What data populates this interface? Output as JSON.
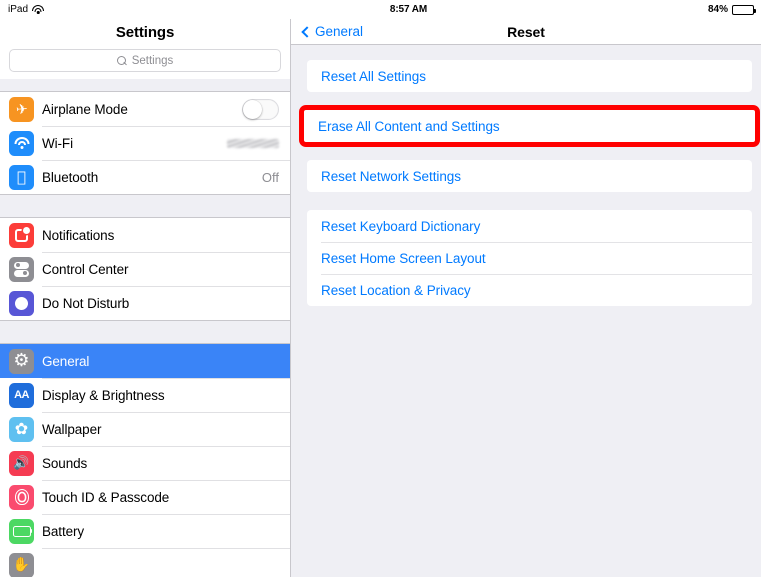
{
  "status_bar": {
    "device_label": "iPad",
    "wifi_icon": "wifi-icon",
    "time": "8:57 AM",
    "battery_percent": "84%",
    "battery_level": 84,
    "battery_icon": "battery-icon"
  },
  "sidebar": {
    "title": "Settings",
    "search": {
      "placeholder": "Settings",
      "value": "",
      "icon": "search-icon"
    },
    "groups": [
      {
        "items": [
          {
            "label": "Airplane Mode",
            "icon": "airplane-icon",
            "icon_class": "ic-airplane",
            "accessory": "toggle",
            "toggle_on": false,
            "selected": false
          },
          {
            "label": "Wi-Fi",
            "icon": "wifi-icon",
            "icon_class": "ic-wifi",
            "accessory": "redacted",
            "value": "",
            "selected": false
          },
          {
            "label": "Bluetooth",
            "icon": "bluetooth-icon",
            "icon_class": "ic-bt",
            "accessory": "value",
            "value": "Off",
            "selected": false
          }
        ]
      },
      {
        "items": [
          {
            "label": "Notifications",
            "icon": "notifications-icon",
            "icon_class": "ic-notif",
            "accessory": "none",
            "selected": false
          },
          {
            "label": "Control Center",
            "icon": "control-center-icon",
            "icon_class": "ic-cc",
            "accessory": "none",
            "selected": false
          },
          {
            "label": "Do Not Disturb",
            "icon": "moon-icon",
            "icon_class": "ic-dnd",
            "accessory": "none",
            "selected": false
          }
        ]
      },
      {
        "items": [
          {
            "label": "General",
            "icon": "gear-icon",
            "icon_class": "ic-gear",
            "accessory": "none",
            "selected": true
          },
          {
            "label": "Display & Brightness",
            "icon": "display-brightness-icon",
            "icon_class": "ic-aa",
            "accessory": "none",
            "selected": false
          },
          {
            "label": "Wallpaper",
            "icon": "wallpaper-icon",
            "icon_class": "ic-wall",
            "accessory": "none",
            "selected": false
          },
          {
            "label": "Sounds",
            "icon": "speaker-icon",
            "icon_class": "ic-sound",
            "accessory": "none",
            "selected": false
          },
          {
            "label": "Touch ID & Passcode",
            "icon": "fingerprint-icon",
            "icon_class": "ic-touchid",
            "accessory": "none",
            "selected": false
          },
          {
            "label": "Battery",
            "icon": "battery-icon",
            "icon_class": "ic-batt",
            "accessory": "none",
            "selected": false
          },
          {
            "label": "",
            "icon": "privacy-icon",
            "icon_class": "ic-privacy",
            "accessory": "none",
            "selected": false
          }
        ]
      }
    ]
  },
  "detail": {
    "back_label": "General",
    "back_icon": "chevron-left-icon",
    "title": "Reset",
    "cards": [
      {
        "highlighted": false,
        "rows": [
          {
            "label": "Reset All Settings"
          }
        ]
      },
      {
        "highlighted": true,
        "rows": [
          {
            "label": "Erase All Content and Settings"
          }
        ]
      },
      {
        "highlighted": false,
        "rows": [
          {
            "label": "Reset Network Settings"
          }
        ]
      },
      {
        "highlighted": false,
        "rows": [
          {
            "label": "Reset Keyboard Dictionary"
          },
          {
            "label": "Reset Home Screen Layout"
          },
          {
            "label": "Reset Location & Privacy"
          }
        ]
      }
    ]
  },
  "colors": {
    "accent_blue": "#007aff",
    "selection_blue": "#3a84f7",
    "highlight_red": "#ff0000",
    "panel_gray": "#efeff4",
    "separator": "#c8c7cc"
  }
}
